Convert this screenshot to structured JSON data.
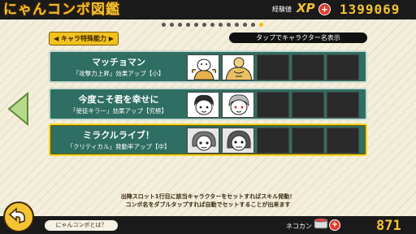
{
  "header": {
    "title": "にゃんコンボ図鑑",
    "xp_small_label": "経験値",
    "xp_word": "XP",
    "xp_value": "1399069",
    "xp_plus": "+"
  },
  "pagination": {
    "total": 13,
    "active_index": 12
  },
  "tabs": {
    "ability_label": "キャラ特殊能力",
    "tap_hint": "タップでキャラクター名表示"
  },
  "combos": [
    {
      "name": "マッチョマン",
      "effect": "「攻撃力上昇」効果アップ【小】",
      "slots_filled": 2,
      "slots_total": 5,
      "selected": false
    },
    {
      "name": "今度こそ君を幸せに",
      "effect": "「使徒キラー」効果アップ【究極】",
      "slots_filled": 2,
      "slots_total": 5,
      "selected": false
    },
    {
      "name": "ミラクルライブ！",
      "effect": "「クリティカル」発動率アップ【中】",
      "slots_filled": 2,
      "slots_total": 5,
      "selected": true
    }
  ],
  "info_text": {
    "line1": "出陣スロット1行目に該当キャラクターをセットすればスキル発動！",
    "line2": "コンボ名をダブルタップすれば自動でセットすることが出来ます"
  },
  "footer": {
    "help_label": "にゃんコンボとは？",
    "catfood_label": "ネコカン",
    "catfood_plus": "+",
    "catfood_value": "871"
  },
  "colors": {
    "accent": "#f3c331",
    "row_bg": "#2f6e62",
    "selected_border": "#f4d323"
  },
  "icons": {
    "back": "back-arrow-icon",
    "prev": "left-arrow-icon",
    "catfood": "cat-food-can-icon"
  }
}
